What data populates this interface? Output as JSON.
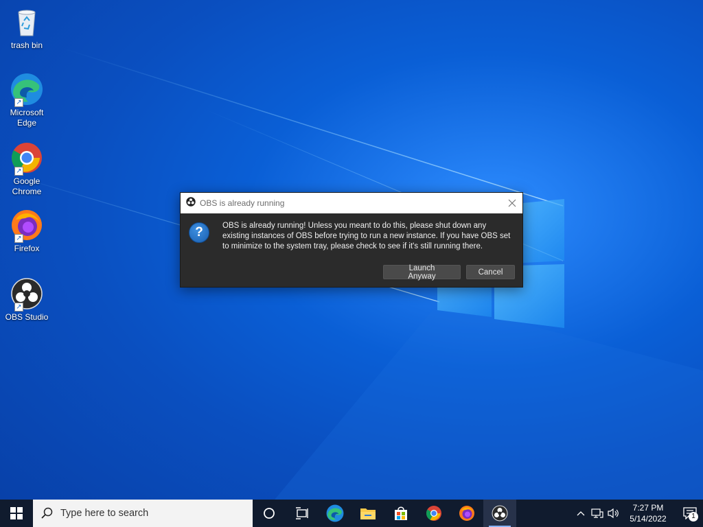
{
  "desktop": {
    "icons": [
      {
        "label": "trash bin",
        "icon": "recycle-bin-icon"
      },
      {
        "label": "Microsoft Edge",
        "icon": "edge-icon"
      },
      {
        "label": "Google Chrome",
        "icon": "chrome-icon"
      },
      {
        "label": "Firefox",
        "icon": "firefox-icon"
      },
      {
        "label": "OBS Studio",
        "icon": "obs-icon"
      }
    ]
  },
  "dialog": {
    "title": "OBS is already running",
    "message": "OBS is already running! Unless you meant to do this, please shut down any existing instances of OBS before trying to run a new instance. If you have OBS set to minimize to the system tray, please check to see if it's still running there.",
    "launch_label": "Launch Anyway",
    "cancel_label": "Cancel"
  },
  "taskbar": {
    "search_placeholder": "Type here to search",
    "time": "7:27 PM",
    "date": "5/14/2022",
    "notification_count": "1"
  },
  "colors": {
    "desktop_blue": "#0a5fd6",
    "taskbar_bg": "#101b2e",
    "dialog_bg": "#2b2b2b"
  }
}
